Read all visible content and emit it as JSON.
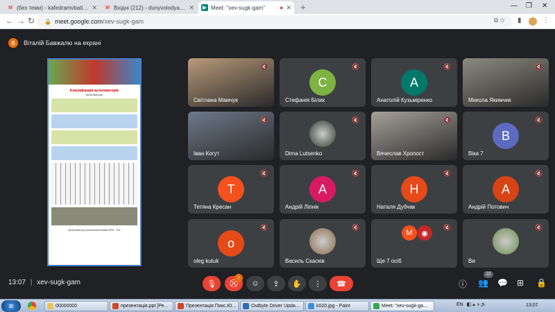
{
  "browser": {
    "tabs": [
      {
        "label": "(без теми) - kafedramvbati@gm",
        "favicon": "gmail"
      },
      {
        "label": "Вхідні (212) - dunyvolodya@gmail",
        "favicon": "gmail"
      },
      {
        "label": "Meet: \"xev-sugk-gam\"",
        "favicon": "meet"
      }
    ],
    "url_host": "meet.google.com",
    "url_path": "/xev-sugk-gam"
  },
  "presenter": {
    "initial": "В",
    "text": "Віталій Бавжалю на екрані"
  },
  "participants": [
    {
      "name": "Світлана Мамчук",
      "kind": "photo",
      "color": "#b89a7a"
    },
    {
      "name": "Стефанія Білик",
      "kind": "avatar",
      "initial": "С",
      "color": "#7cb342"
    },
    {
      "name": "Анатолій Кузьміренко",
      "kind": "avatar",
      "initial": "А",
      "color": "#00796b"
    },
    {
      "name": "Микола Якимчик",
      "kind": "photo",
      "color": "#8d8a80"
    },
    {
      "name": "Іван Когут",
      "kind": "photo",
      "color": "#6d7a8a"
    },
    {
      "name": "Dima Lutsenko",
      "kind": "circle-photo",
      "color": "#2f3b2f"
    },
    {
      "name": "Вячеслав Хропост",
      "kind": "photo",
      "color": "#a6a29a"
    },
    {
      "name": "Вікa 7",
      "kind": "avatar",
      "initial": "В",
      "color": "#5c6bc0"
    },
    {
      "name": "Тетяна Кресан",
      "kind": "avatar",
      "initial": "Т",
      "color": "#f4511e"
    },
    {
      "name": "Андрій Ліпнік",
      "kind": "avatar",
      "initial": "А",
      "color": "#d81b60"
    },
    {
      "name": "Наталя Дубчак",
      "kind": "avatar",
      "initial": "Н",
      "color": "#e64a19"
    },
    {
      "name": "Андрій Потович",
      "kind": "avatar",
      "initial": "А",
      "color": "#d84315"
    },
    {
      "name": "oleg kutuk",
      "kind": "avatar",
      "initial": "o",
      "color": "#e64a19"
    },
    {
      "name": "Василь Скасків",
      "kind": "circle-photo",
      "color": "#8a6d4a"
    },
    {
      "name": "Ще 7 осіб",
      "kind": "pair",
      "initial": "М",
      "color": "#f4511e"
    },
    {
      "name": "Ви",
      "kind": "circle-photo",
      "color": "#6b8e4e"
    }
  ],
  "slide": {
    "title": "Класифікація культиваторів",
    "subtitle": "Культиватори",
    "footer": "Культиватор рослинопольовий КРН - 5,6"
  },
  "meeting": {
    "time": "13:07",
    "code": "xev-sugk-gam",
    "participant_count": "22",
    "cam_badge": "!"
  },
  "taskbar": {
    "items": [
      {
        "label": "00000000",
        "color": "#e8c35a"
      },
      {
        "label": "презентація.ppt [Ре...",
        "color": "#d24726"
      },
      {
        "label": "Презентація Пикс.Ю...",
        "color": "#d24726"
      },
      {
        "label": "Outbyte Driver Upda...",
        "color": "#2d6bb3"
      },
      {
        "label": "k020.jpg - Paint",
        "color": "#3b8ed8"
      },
      {
        "label": "Meet: \"xev-sugk-ga...",
        "color": "#34a853"
      }
    ],
    "lang": "EN",
    "clock": "13:07"
  }
}
